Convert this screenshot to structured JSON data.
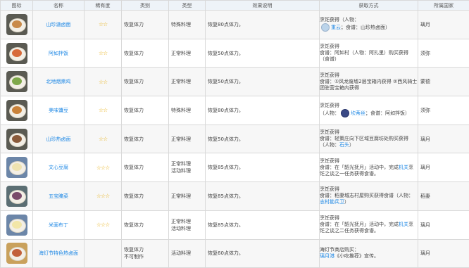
{
  "headers": [
    "图标",
    "名称",
    "稀有度",
    "类别",
    "类型",
    "效果说明",
    "获取方式",
    "所属国家"
  ],
  "rows": [
    {
      "icon": "dish-icon-mushroom",
      "food_color": "#c98a4a",
      "rarity_class": "r2",
      "name": "山珍溏卤面",
      "stars": "☆☆",
      "category": "恢复体力",
      "types": [
        "特殊料理"
      ],
      "effect": "恢复80点体力。",
      "source_lines": [
        "烹饪获得（人物：",
        "重云",
        "；食谱：",
        "山珍热卤面）"
      ],
      "avatar": "chongyun",
      "country": "璃月"
    },
    {
      "icon": "dish-icon-rice",
      "food_color": "#d76a3a",
      "rarity_class": "r2",
      "name": "阿如拌饭",
      "stars": "☆☆",
      "category": "恢复体力",
      "types": [
        "正常料理"
      ],
      "effect": "恢复50点体力。",
      "source_lines": [
        "烹饪获得",
        "食谱：阿如村（人物：阿扎里）购买获得",
        "（食谱）"
      ],
      "avatar": "",
      "country": "须弥"
    },
    {
      "icon": "dish-icon-chicken",
      "food_color": "#7fa84a",
      "rarity_class": "r2",
      "name": "北地烟熏鸡",
      "stars": "☆☆",
      "category": "恢复体力",
      "types": [
        "正常料理"
      ],
      "effect": "恢复50点体力。",
      "source_lines": [
        "烹饪获得",
        "食谱：①风龙废墟2层宝箱内获得 ②西风",
        "骑士团驻营宝箱内获得"
      ],
      "avatar": "",
      "country": "蒙德"
    },
    {
      "icon": "dish-icon-pie",
      "food_color": "#c9823a",
      "rarity_class": "r2",
      "name": "美味馕豆",
      "stars": "☆☆",
      "category": "恢复体力",
      "types": [
        "特殊料理"
      ],
      "effect": "恢复80点体力。",
      "source_lines": [
        "烹饪获得",
        "（人物：",
        "坎蒂丝",
        "；食谱：",
        "阿如拌饭）"
      ],
      "avatar": "kamisato",
      "country": "须弥"
    },
    {
      "icon": "dish-icon-noodle",
      "food_color": "#8a5a3a",
      "rarity_class": "r2",
      "name": "山珍热卤面",
      "stars": "☆☆",
      "category": "恢复体力",
      "types": [
        "正常料理"
      ],
      "effect": "恢复50点体力。",
      "source_lines": [
        "烹饪获得",
        "食谱：轻策庄向下区域豆腐坊处购买获得",
        "（人物：",
        "石头",
        "）"
      ],
      "avatar": "",
      "country": "璃月"
    },
    {
      "icon": "dish-icon-tofu",
      "food_color": "#efe3b0",
      "rarity_class": "r4",
      "name": "文心豆腐",
      "stars": "☆☆☆",
      "category": "恢复体力",
      "types": [
        "正常料理",
        "活动料理"
      ],
      "effect": "恢复85点体力。",
      "source_lines": [
        "烹饪获得",
        "食谱：在「韶光抚月」活动中，完成",
        "机关",
        "烹饪之谈之一任务获得食谱。"
      ],
      "avatar": "",
      "country": "璃月"
    },
    {
      "icon": "dish-icon-sashimi",
      "food_color": "#7a4a6a",
      "rarity_class": "r3",
      "name": "五宝腌菜",
      "stars": "☆☆☆",
      "category": "恢复体力",
      "types": [
        "正常料理"
      ],
      "effect": "恢复85点体力。",
      "source_lines": [
        "烹饪获得",
        "食谱：稻妻城志村屋购买获得食谱（人",
        "物：",
        "志村勘兵卫",
        "）"
      ],
      "avatar": "",
      "country": "稻妻"
    },
    {
      "icon": "dish-icon-pudding",
      "food_color": "#f2e6a8",
      "rarity_class": "r4",
      "name": "米面布丁",
      "stars": "☆☆☆",
      "category": "恢复体力",
      "types": [
        "正常料理",
        "活动料理"
      ],
      "effect": "恢复85点体力。",
      "source_lines": [
        "烹饪获得",
        "食谱：在「韶光抚月」活动中，完成",
        "机关",
        "烹饪之谈之二任务获得食谱。"
      ],
      "avatar": "",
      "country": "璃月"
    },
    {
      "icon": "dish-icon-festival",
      "food_color": "#c2603a",
      "rarity_class": "r5",
      "name": "海灯节特色热卤面",
      "stars": "",
      "category_lines": [
        "恢复体力",
        "不可制作"
      ],
      "types": [
        "活动料理"
      ],
      "effect": "恢复60点体力。",
      "source_lines": [
        "海灯节商店购买：",
        "璃月港",
        "《小吃推荐》宣传。"
      ],
      "avatar": "",
      "country": "璃月"
    }
  ]
}
